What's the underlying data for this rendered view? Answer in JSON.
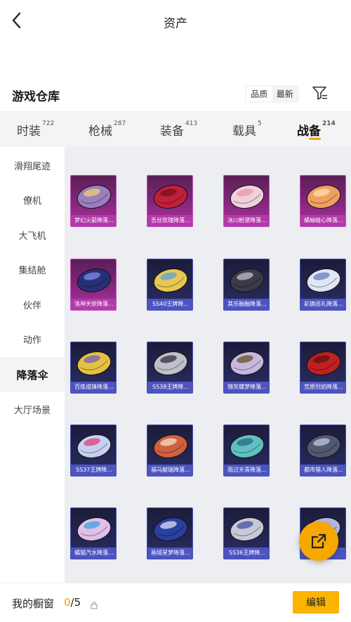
{
  "header": {
    "title": "资产"
  },
  "section": {
    "title": "游戏仓库"
  },
  "sort": {
    "options": [
      "品质",
      "最新"
    ]
  },
  "tabs": [
    {
      "label": "时装",
      "count": "722"
    },
    {
      "label": "枪械",
      "count": "287"
    },
    {
      "label": "装备",
      "count": "413"
    },
    {
      "label": "载具",
      "count": "5"
    },
    {
      "label": "战备",
      "count": "214"
    }
  ],
  "sidebar": {
    "items": [
      {
        "label": "滑翔尾迹"
      },
      {
        "label": "僚机"
      },
      {
        "label": "大飞机"
      },
      {
        "label": "集结舱"
      },
      {
        "label": "伙伴"
      },
      {
        "label": "动作"
      },
      {
        "label": "降落伞"
      },
      {
        "label": "大厅场景"
      }
    ]
  },
  "items": [
    {
      "label": "梦幻火箭降落...",
      "rarity": "purple",
      "color": "#9b7fbf",
      "accent": "#f2d26a"
    },
    {
      "label": "吾丝玫瑰降落...",
      "rarity": "purple",
      "color": "#c0203a",
      "accent": "#7a0f20"
    },
    {
      "label": "冰川粉黛降落...",
      "rarity": "purple",
      "color": "#f0d0dc",
      "accent": "#e89aa8"
    },
    {
      "label": "橘柚蛙心降落...",
      "rarity": "purple",
      "color": "#f0a060",
      "accent": "#ffe0b0"
    },
    {
      "label": "洛神天依降落...",
      "rarity": "purple",
      "color": "#2a2f7a",
      "accent": "#7d8cf0"
    },
    {
      "label": "SS40王牌降...",
      "rarity": "blue",
      "color": "#e8c850",
      "accent": "#5aa0e0"
    },
    {
      "label": "其乐融融降落...",
      "rarity": "blue",
      "color": "#3a3a48",
      "accent": "#c0c0cc"
    },
    {
      "label": "彩旗巡礼降落...",
      "rarity": "blue",
      "color": "#dfe6f5",
      "accent": "#6a7ac0"
    },
    {
      "label": "百炼成锋降落...",
      "rarity": "blue",
      "color": "#e6c040",
      "accent": "#7060c0"
    },
    {
      "label": "SS38王牌降...",
      "rarity": "blue",
      "color": "#c0c0c8",
      "accent": "#303040"
    },
    {
      "label": "锦灰蝶梦降落...",
      "rarity": "blue",
      "color": "#c8b8e0",
      "accent": "#6a5020"
    },
    {
      "label": "荒原烈焰降落...",
      "rarity": "blue",
      "color": "#c02020",
      "accent": "#601010"
    },
    {
      "label": "SS37王牌降...",
      "rarity": "blue",
      "color": "#c8d0f0",
      "accent": "#e04070"
    },
    {
      "label": "福马献瑞降落...",
      "rarity": "blue",
      "color": "#d06040",
      "accent": "#f0e0c0"
    },
    {
      "label": "雨过天青降落...",
      "rarity": "blue",
      "color": "#60c0c0",
      "accent": "#2a6a80"
    },
    {
      "label": "都市猎人降落...",
      "rarity": "blue",
      "color": "#505a70",
      "accent": "#c0c8d8"
    },
    {
      "label": "橘猫汽水降落...",
      "rarity": "blue",
      "color": "#e0c0e8",
      "accent": "#40a0e0"
    },
    {
      "label": "画境星梦降落...",
      "rarity": "blue",
      "color": "#2a40a0",
      "accent": "#e0e0f0"
    },
    {
      "label": "SS36王牌降...",
      "rarity": "blue",
      "color": "#c8c8d8",
      "accent": "#4050a0"
    },
    {
      "label": "",
      "rarity": "blue",
      "color": "#b0b8e0",
      "accent": "#e0a0c0"
    }
  ],
  "bottom": {
    "showcase_label": "我的橱窗",
    "showcase_current": "0",
    "showcase_total": "/5",
    "edit_label": "编辑"
  },
  "colors": {
    "accent": "#f5a200",
    "purple_rarity": "#b33aaa",
    "blue_rarity": "#4d54c0"
  }
}
